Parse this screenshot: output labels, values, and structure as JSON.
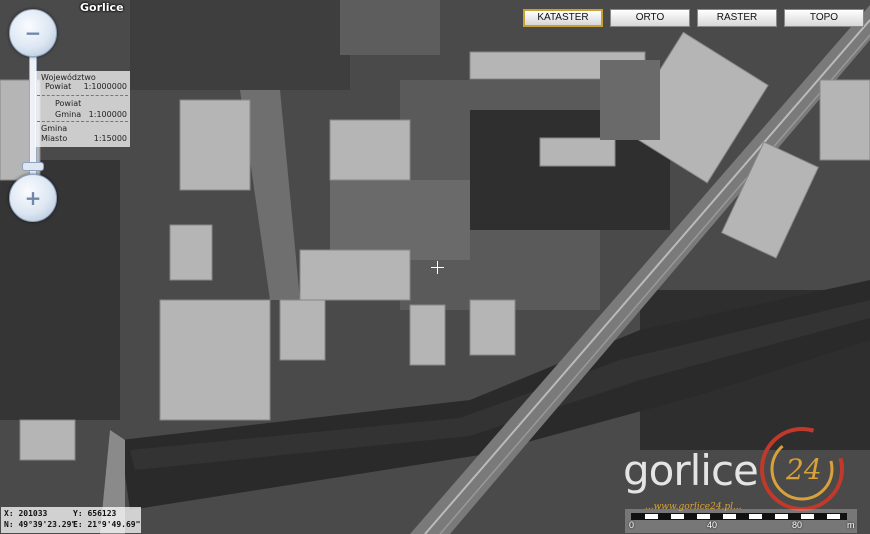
{
  "place_name": "Gorlice",
  "zoom": {
    "in_icon": "zoom-in-icon",
    "out_icon": "zoom-out-icon",
    "in_glyph": "+",
    "out_glyph": "−"
  },
  "scale_levels": {
    "title": "Województwo",
    "rows": [
      {
        "label": "Powiat",
        "value": "1:1000000"
      },
      {
        "label": "Powiat",
        "value": ""
      },
      {
        "label": "Gmina",
        "value": "1:100000"
      },
      {
        "label": "Gmina",
        "value": ""
      },
      {
        "label": "Miasto",
        "value": "1:15000"
      }
    ]
  },
  "layers": [
    {
      "label": "KATASTER",
      "active": true
    },
    {
      "label": "ORTO",
      "active": false
    },
    {
      "label": "RASTER",
      "active": false
    },
    {
      "label": "TOPO",
      "active": false
    }
  ],
  "coordinates": {
    "x": "X: 201033",
    "y": "Y: 656123",
    "lat": "N: 49°39'23.29\"",
    "lon": "E: 21°9'49.69\""
  },
  "logo": {
    "text": "gorlice",
    "number": "24",
    "tagline": "...www.gorlice24.pl..."
  },
  "scale_bar": {
    "ticks": [
      "0",
      "40",
      "80",
      "m"
    ]
  },
  "colors": {
    "accent": "#c8a133",
    "logo_ring": "#c0392b",
    "logo_gold": "#d9a13a"
  }
}
